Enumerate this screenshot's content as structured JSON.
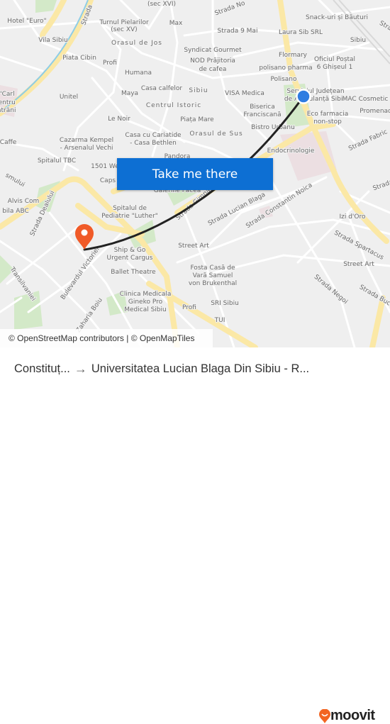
{
  "map": {
    "labels": [
      "(sec XVI)",
      "Turnul Pielarilor",
      "(sec XV)",
      "Max",
      "Strada No",
      "Strada 9 Mai",
      "Hotel \"Euro\"",
      "Vila Sibiu",
      "Strada",
      "Orasul de Jos",
      "Piata Cibin",
      "Profi",
      "Humana",
      "Syndicat Gourmet",
      "NOD Prăjitoria",
      "de cafea",
      "Sibiu",
      "Casa calfelor",
      "Maya",
      "Centrul Istoric",
      "Unitel",
      "alul \"Carl",
      "\" - Centru",
      "ru Bătrâni",
      "Le Noir",
      "Piața Mare",
      "Orasul de Sus",
      "Casa cu Cariatide",
      "- Casa Bethlen",
      "Cazarma Kempel",
      "- Arsenalul Vechi",
      "ante Caffe",
      "Spitalul TBC",
      "Pandora",
      "1501 We",
      "Caps",
      "Galeriile Pacea",
      "smului",
      "Alvis Com",
      "bila ABC",
      "Strada Dealului",
      "Spitalul de",
      "Pediatrie \"Luther\"",
      "Ship & Go",
      "Urgent Cargus",
      "Ballet Theatre",
      "Clinica Medicala",
      "Gineko Pro",
      "Medical Sibiu",
      "Profi",
      "Bulevardul Victoriei",
      "Transilvaniei",
      "Zaharia Boiu",
      "Street Art",
      "Fosta Casă de",
      "Vară Samuel",
      "von Brukenthal",
      "SRI Sibiu",
      "TUI",
      "Strada Gimnaziului",
      "Strada Lucian Blaga",
      "Strada Constantin Noica",
      "Izi d'Oro",
      "Strada Spartacus",
      "Street Art",
      "Strada Negoi",
      "Strada Buce",
      "Strada S",
      "Strada Fabric",
      "Snack-uri și Băuturi",
      "Laura Sib SRL",
      "Sibiu",
      "Flormary",
      "Oficiul Poștal",
      "6 Ghișeul 1",
      "polisano pharma",
      "Polisano",
      "Serviciul Județean",
      "de Ambulanță Sibiu",
      "VISA Medica",
      "Biserica",
      "Franciscană",
      "MAC Cosmetic",
      "Promenad",
      "Eco farmacia",
      "non-stop",
      "Bistro Urbanu",
      "Endocrinologie",
      "Strad",
      "Spitalul TBC"
    ],
    "origin_color": "#2f7de1",
    "destination_color": "#f05a28",
    "route_color": "#222222",
    "main_road_color": "#fbe8a6",
    "park_color": "#cfe8c4"
  },
  "cta": {
    "label": "Take me there"
  },
  "attribution": "© OpenStreetMap contributors | © OpenMapTiles",
  "footer": {
    "from": "Constituț...",
    "arrow": "→",
    "to": "Universitatea Lucian Blaga Din Sibiu - R...",
    "brand": "moovit",
    "brand_color": "#f26522"
  }
}
